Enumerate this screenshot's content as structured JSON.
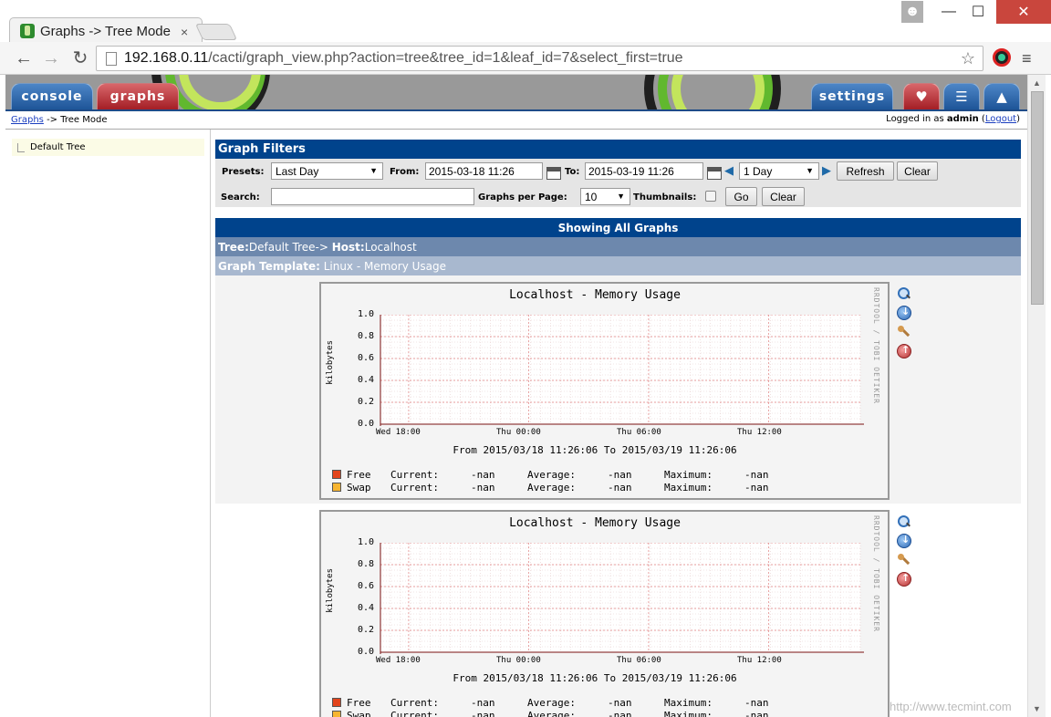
{
  "browser": {
    "tab_title": "Graphs -> Tree Mode",
    "url_host": "192.168.0.11",
    "url_path": "/cacti/graph_view.php?action=tree&tree_id=1&leaf_id=7&select_first=true",
    "close_glyph": "×",
    "min_glyph": "—",
    "max_glyph": "☐",
    "winclose_glyph": "✕",
    "back_glyph": "←",
    "forward_glyph": "→",
    "reload_glyph": "↻",
    "star_glyph": "☆",
    "menu_glyph": "≡"
  },
  "nav": {
    "console": "console",
    "graphs": "graphs",
    "settings": "settings"
  },
  "breadcrumb": {
    "link": "Graphs",
    "sep": " -> ",
    "current": "Tree Mode"
  },
  "login": {
    "prefix": "Logged in as ",
    "user": "admin",
    "open": " (",
    "logout": "Logout",
    "close": ")"
  },
  "tree": {
    "item": "Default Tree"
  },
  "filters": {
    "heading": "Graph Filters",
    "presets_label": "Presets:",
    "presets_value": "Last Day",
    "from_label": "From:",
    "from_value": "2015-03-18 11:26",
    "to_label": "To:",
    "to_value": "2015-03-19 11:26",
    "span_value": "1 Day",
    "refresh": "Refresh",
    "clear": "Clear",
    "search_label": "Search:",
    "search_value": "",
    "per_page_label": "Graphs per Page:",
    "per_page_value": "10",
    "thumbnails_label": "Thumbnails:",
    "go": "Go",
    "clear2": "Clear"
  },
  "listing": {
    "showing": "Showing All Graphs",
    "tree_label": "Tree:",
    "tree_value": "Default Tree-> ",
    "host_label": "Host:",
    "host_value": "Localhost",
    "template_label": "Graph Template:",
    "template_value": " Linux - Memory Usage"
  },
  "graphs": [
    {
      "title": "Localhost - Memory Usage",
      "vertical_label": "kilobytes",
      "watermark": "RRDTOOL / TOBI OETIKER",
      "y_ticks": [
        "1.0",
        "0.8",
        "0.6",
        "0.4",
        "0.2",
        "0.0"
      ],
      "x_ticks": [
        "Wed 18:00",
        "Thu 00:00",
        "Thu 06:00",
        "Thu 12:00"
      ],
      "range_text": "From 2015/03/18 11:26:06 To 2015/03/19 11:26:06",
      "legend": [
        {
          "name": "Free",
          "color": "#e2441b",
          "current": "-nan",
          "average": "-nan",
          "maximum": "-nan"
        },
        {
          "name": "Swap",
          "color": "#f7b531",
          "current": "-nan",
          "average": "-nan",
          "maximum": "-nan"
        }
      ]
    },
    {
      "title": "Localhost - Memory Usage",
      "vertical_label": "kilobytes",
      "watermark": "RRDTOOL / TOBI OETIKER",
      "y_ticks": [
        "1.0",
        "0.8",
        "0.6",
        "0.4",
        "0.2",
        "0.0"
      ],
      "x_ticks": [
        "Wed 18:00",
        "Thu 00:00",
        "Thu 06:00",
        "Thu 12:00"
      ],
      "range_text": "From 2015/03/18 11:26:06 To 2015/03/19 11:26:06",
      "legend": [
        {
          "name": "Free",
          "color": "#e2441b",
          "current": "-nan",
          "average": "-nan",
          "maximum": "-nan"
        },
        {
          "name": "Swap",
          "color": "#f7b531",
          "current": "-nan",
          "average": "-nan",
          "maximum": "-nan"
        }
      ]
    }
  ],
  "legend_labels": {
    "current": "Current:",
    "average": "Average:",
    "maximum": "Maximum:"
  },
  "watermark_site": "http://www.tecmint.com"
}
